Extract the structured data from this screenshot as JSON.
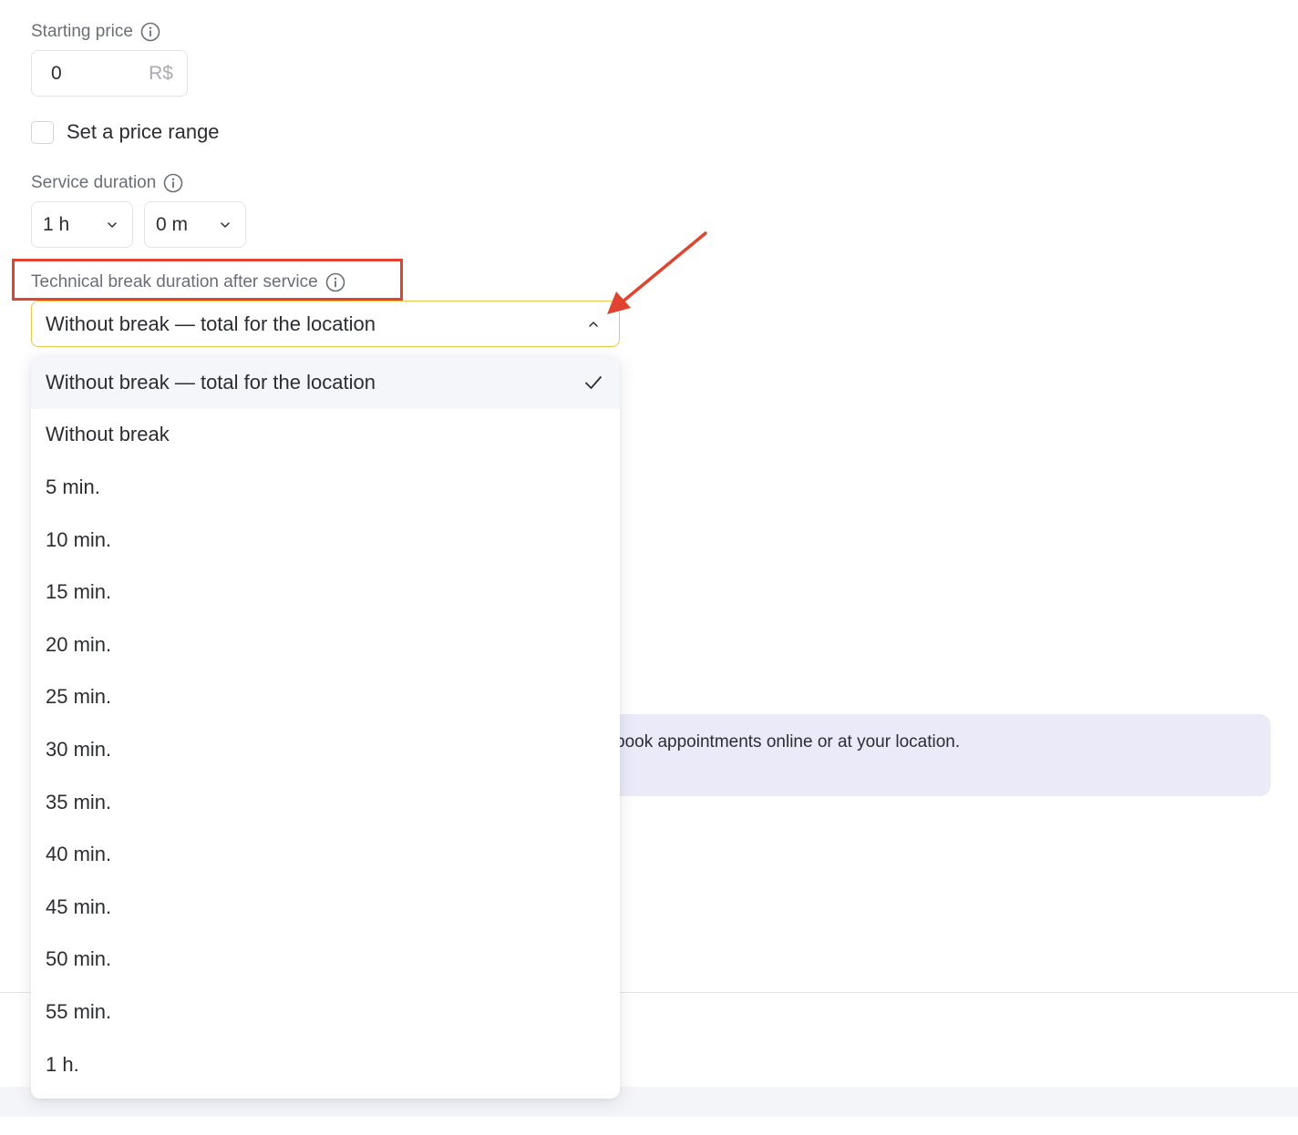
{
  "price": {
    "label": "Starting price",
    "value": "0",
    "currency": "R$"
  },
  "price_range": {
    "label": "Set a price range",
    "checked": false
  },
  "duration": {
    "label": "Service duration",
    "hours": "1 h",
    "minutes": "0 m"
  },
  "technical_break": {
    "label": "Technical break duration after service",
    "selected": "Without break — total for the location",
    "options": [
      "Without break — total for the location",
      "Without break",
      "5 min.",
      "10 min.",
      "15 min.",
      "20 min.",
      "25 min.",
      "30 min.",
      "35 min.",
      "40 min.",
      "45 min.",
      "50 min.",
      "55 min.",
      "1 h."
    ]
  },
  "banner": {
    "text": "book appointments online or at your location."
  },
  "colors": {
    "highlight": "#e0432f",
    "select_focus_border": "#f0c64a",
    "banner_bg": "#ebeaf9"
  },
  "icons": {
    "info": "info-circle-icon",
    "chevron_down": "chevron-down-icon",
    "chevron_up": "chevron-up-icon",
    "check": "check-icon",
    "annotation_arrow": "red-arrow-icon"
  }
}
